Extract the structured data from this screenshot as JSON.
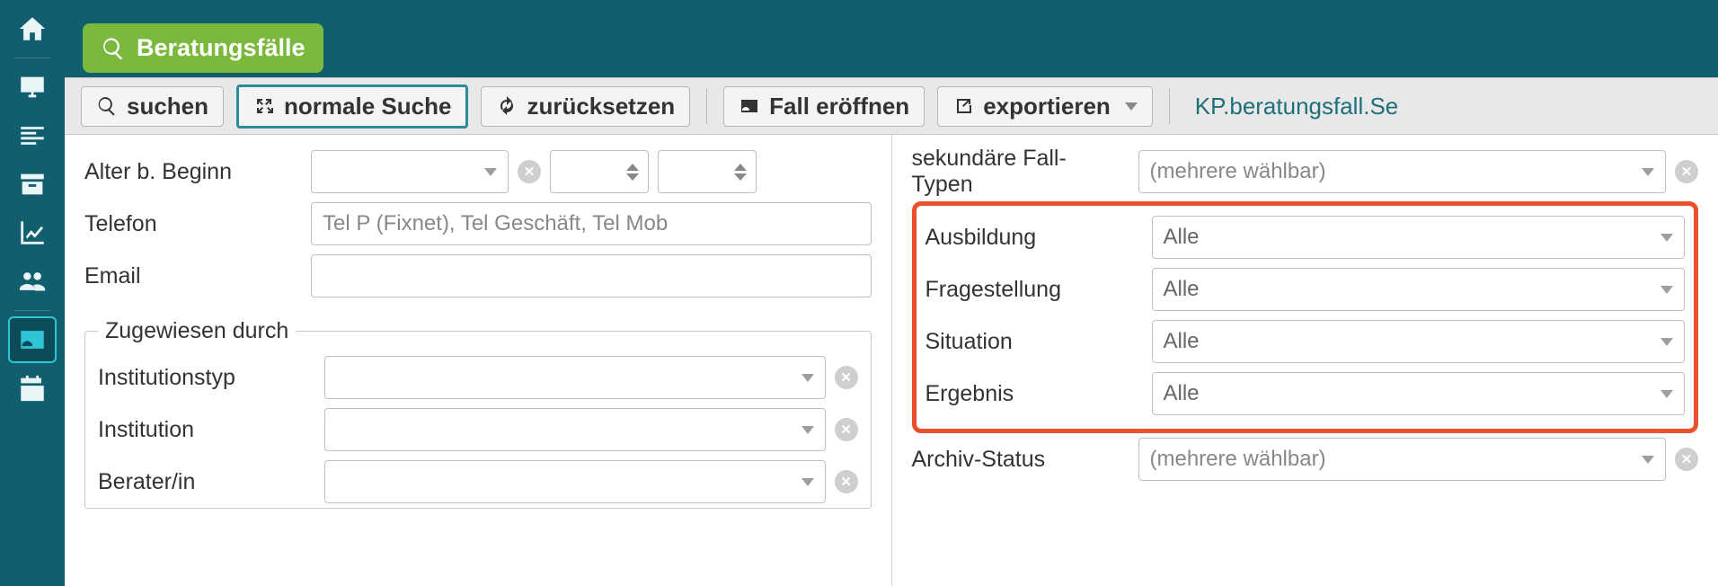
{
  "title": "Beratungsfälle",
  "toolbar": {
    "search": "suchen",
    "mode": "normale Suche",
    "reset": "zurücksetzen",
    "open_case": "Fall eröffnen",
    "export": "exportieren",
    "breadcrumb": "KP.beratungsfall.Se"
  },
  "left": {
    "age_label": "Alter b. Beginn",
    "phone_label": "Telefon",
    "phone_placeholder": "Tel P (Fixnet), Tel Geschäft, Tel Mob",
    "email_label": "Email",
    "assigned_legend": "Zugewiesen durch",
    "inst_type_label": "Institutionstyp",
    "institution_label": "Institution",
    "advisor_label": "Berater/in"
  },
  "right": {
    "sec_types_label": "sekundäre Fall-Typen",
    "multi_placeholder": "(mehrere wählbar)",
    "ausbildung_label": "Ausbildung",
    "frage_label": "Fragestellung",
    "situation_label": "Situation",
    "ergebnis_label": "Ergebnis",
    "alle": "Alle",
    "archiv_label": "Archiv-Status"
  }
}
